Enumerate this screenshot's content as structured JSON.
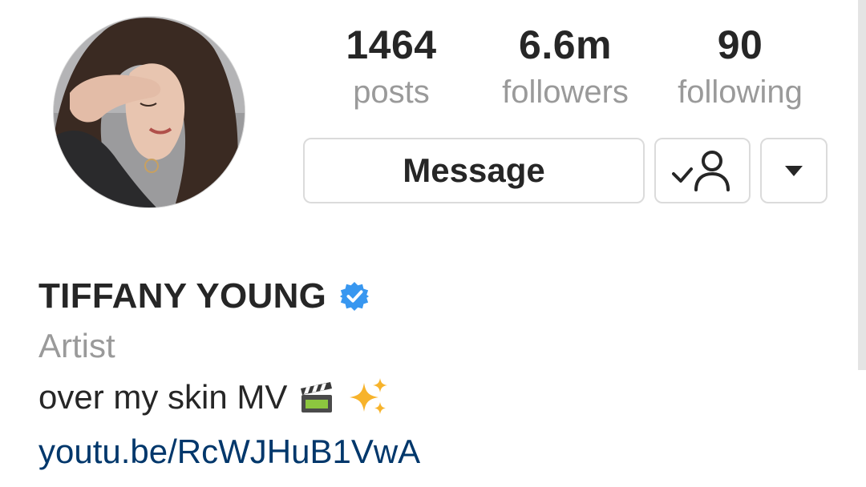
{
  "stats": {
    "posts": {
      "value": "1464",
      "label": "posts"
    },
    "followers": {
      "value": "6.6m",
      "label": "followers"
    },
    "following": {
      "value": "90",
      "label": "following"
    }
  },
  "actions": {
    "message_label": "Message",
    "following_icon": "user-check-icon",
    "dropdown_icon": "triangle-down-icon"
  },
  "profile": {
    "name": "TIFFANY YOUNG",
    "verified": true,
    "category": "Artist",
    "bio_text": "over my skin MV",
    "bio_emojis": [
      "clapper-board-emoji",
      "sparkles-emoji"
    ],
    "link": "youtu.be/RcWJHuB1VwA"
  },
  "colors": {
    "verified_badge": "#3897f0",
    "link": "#00376b",
    "text_primary": "#262626",
    "text_secondary": "#9a9a9a",
    "border": "#dbdbdb"
  }
}
